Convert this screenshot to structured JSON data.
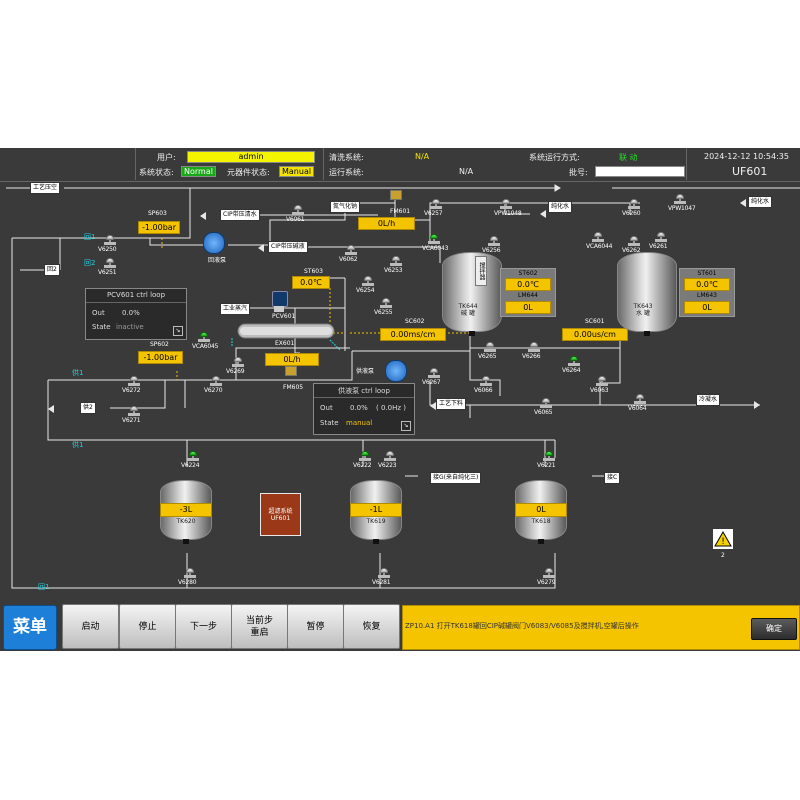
{
  "header": {
    "user_label": "用户:",
    "user_value": "admin",
    "system_status_label": "系统状态:",
    "system_status_value": "Normal",
    "element_status_label": "元器件状态:",
    "element_status_value": "Manual",
    "cleaning_system_label": "清洗系统:",
    "cleaning_system_value": "N/A",
    "running_system_label": "运行系统:",
    "running_system_value": "N/A",
    "run_mode_label": "系统运行方式:",
    "run_mode_value": "联 动",
    "batch_label": "批号:",
    "datetime": "2024-12-12 10:54:35",
    "unit": "UF601"
  },
  "colors": {
    "background": "#3a3a3a",
    "pipe": "#e8e8e8",
    "highlight_pipe": "#f4c400",
    "value_yellow": "#f4c400",
    "valve_open": "#22cc22",
    "menu_blue": "#1e7fd8",
    "info_cyan": "#26d0e0"
  },
  "process": {
    "labels": {
      "process_air": "工艺压空",
      "cip_return": "CIP带压清水",
      "cip_supply_top": "CIP带压碱液",
      "nitrogen": "氮气化钠",
      "pure_water_1": "纯化水",
      "pure_water_2": "纯化水",
      "industrial_steam": "工业蒸汽",
      "process_drain": "工艺下料",
      "cold_water": "冷凝水",
      "return_2": "回2",
      "supply_2": "供2",
      "connect_a": "接G(来自纯化三)",
      "connect_c": "接C",
      "cip_pump": "回液泵",
      "supply_pump": "供液泵",
      "return_1a": "回1",
      "return_1b": "回2",
      "supply_1a": "供1",
      "supply_1b": "供1",
      "return_1c": "回1",
      "ultrafiltration": "超滤系统",
      "ultrafiltration_unit": "UF601"
    },
    "valves": [
      {
        "id": "V6250",
        "on": false
      },
      {
        "id": "V6251",
        "on": false
      },
      {
        "id": "V6061",
        "on": false
      },
      {
        "id": "V6062",
        "on": false
      },
      {
        "id": "V6253",
        "on": false
      },
      {
        "id": "V6254",
        "on": false
      },
      {
        "id": "V6255",
        "on": false
      },
      {
        "id": "V6257",
        "on": false
      },
      {
        "id": "VPW1048",
        "on": false
      },
      {
        "id": "VCA6043",
        "on": true
      },
      {
        "id": "V6256",
        "on": false
      },
      {
        "id": "V6260",
        "on": false
      },
      {
        "id": "VPW1047",
        "on": false
      },
      {
        "id": "VCA6044",
        "on": false
      },
      {
        "id": "V6262",
        "on": false
      },
      {
        "id": "V6261",
        "on": false
      },
      {
        "id": "VCA6045",
        "on": true
      },
      {
        "id": "V6269",
        "on": false
      },
      {
        "id": "V6270",
        "on": false
      },
      {
        "id": "V6272",
        "on": false
      },
      {
        "id": "V6271",
        "on": false
      },
      {
        "id": "V6265",
        "on": false
      },
      {
        "id": "V6266",
        "on": false
      },
      {
        "id": "V6264",
        "on": true
      },
      {
        "id": "V6267",
        "on": false
      },
      {
        "id": "V6066",
        "on": false
      },
      {
        "id": "V6063",
        "on": false
      },
      {
        "id": "V6065",
        "on": false
      },
      {
        "id": "V6064",
        "on": false
      },
      {
        "id": "V6224",
        "on": true
      },
      {
        "id": "V6222",
        "on": true
      },
      {
        "id": "V6223",
        "on": false
      },
      {
        "id": "V6221",
        "on": true
      },
      {
        "id": "V6280",
        "on": false
      },
      {
        "id": "V6281",
        "on": false
      },
      {
        "id": "V6279",
        "on": false
      }
    ],
    "sensors": {
      "SP603": {
        "tag": "SP603",
        "value": "-1.00bar"
      },
      "SP602": {
        "tag": "SP602",
        "value": "-1.00bar"
      },
      "FM601": {
        "tag": "FM601",
        "value": "0L/h"
      },
      "ST603": {
        "tag": "ST603",
        "value": "0.0℃"
      },
      "FM605": {
        "tag": "FM605",
        "value": "0L/h"
      },
      "SC602": {
        "tag": "SC602",
        "value": "0.00ms/cm"
      },
      "SC601": {
        "tag": "SC601",
        "value": "0.00us/cm"
      },
      "PCV601": {
        "tag": "PCV601"
      },
      "EX601": {
        "tag": "EX601"
      }
    },
    "pcv_loop": {
      "title": "PCV601 ctrl loop",
      "out_label": "Out",
      "out_value": "0.0%",
      "state_label": "State",
      "state_value": "inactive"
    },
    "pump_loop": {
      "title": "供液泵 ctrl loop",
      "out_label": "Out",
      "out_value": "0.0%",
      "out_hz": "( 0.0Hz )",
      "state_label": "State",
      "state_value": "manual"
    },
    "tanks": {
      "TK644": {
        "name": "TK644",
        "sub": "碱  罐",
        "temp_tag": "ST602",
        "temp": "0.0℃",
        "level_tag": "LM644",
        "level": "0L",
        "side": "搅拌器"
      },
      "TK643": {
        "name": "TK643",
        "sub": "水  罐",
        "temp_tag": "ST601",
        "temp": "0.0℃",
        "level_tag": "LM643",
        "level": "0L"
      },
      "TK620": {
        "name": "TK620",
        "level": "-3L"
      },
      "TK619": {
        "name": "TK619",
        "level": "-1L"
      },
      "TK618": {
        "name": "TK618",
        "level": "0L"
      }
    },
    "alarm": {
      "count": "2"
    }
  },
  "toolbar": {
    "menu": "菜单",
    "start": "启动",
    "stop": "停止",
    "next": "下一步",
    "restart_line1": "当前步",
    "restart_line2": "重启",
    "pause": "暂停",
    "resume": "恢复",
    "message": "ZP10.A1  打开TK618罐回CIP碱罐阀门V6083/V6085及搅拌机,空罐后操作",
    "confirm": "确定"
  }
}
